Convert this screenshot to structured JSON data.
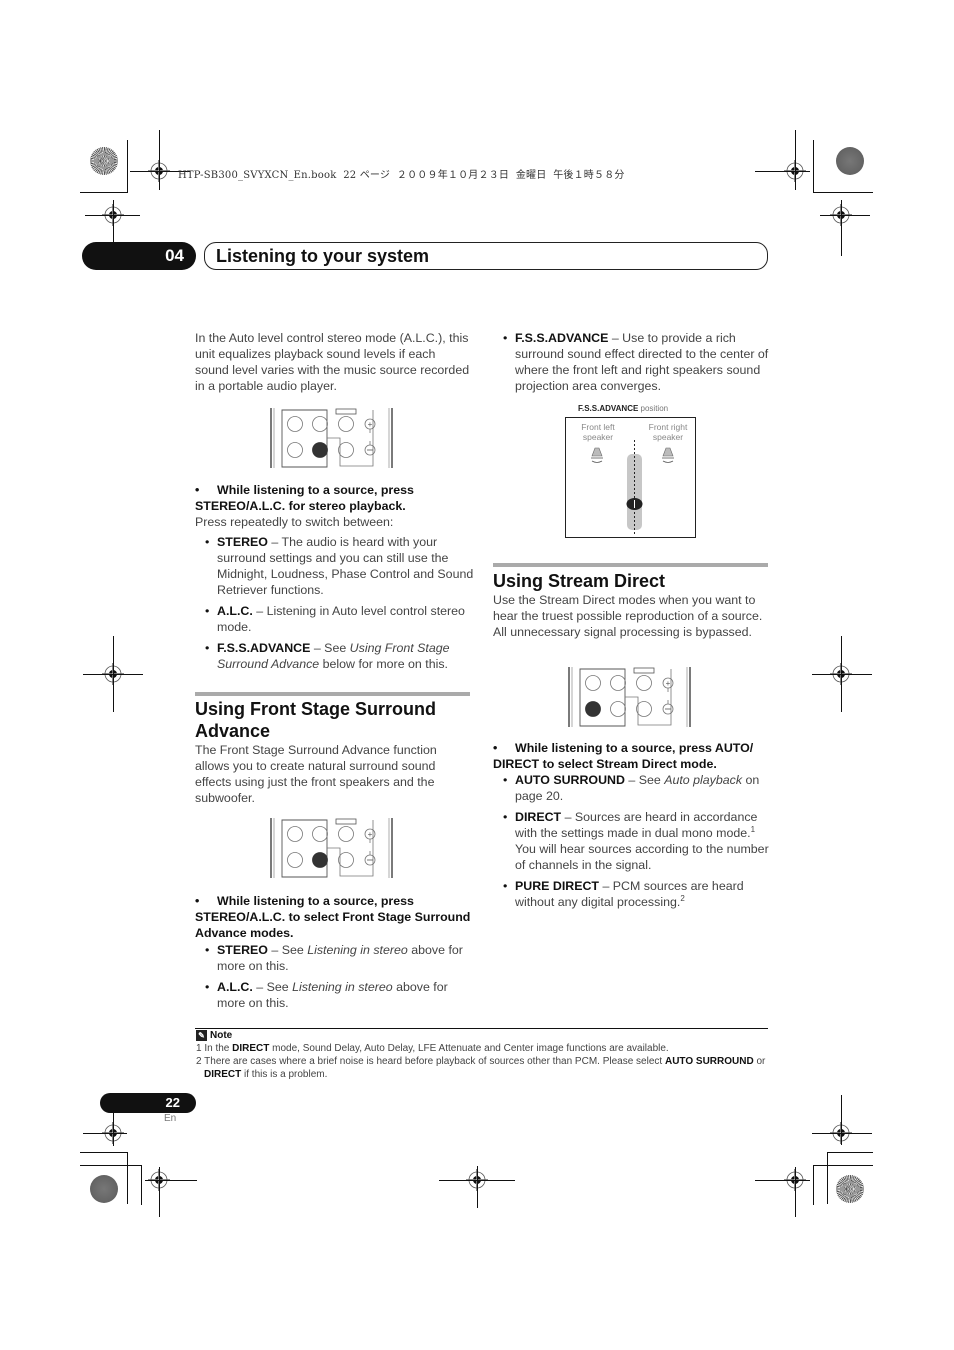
{
  "print_header": "HTP-SB300_SVYXCN_En.book  22 ページ  ２００９年１０月２３日  金曜日  午後１時５８分",
  "chapter": {
    "number": "04",
    "title": "Listening to your system"
  },
  "left_column": {
    "intro": "In the Auto level control stereo mode (A.L.C.), this unit equalizes playback sound levels if each sound level varies with the music source recorded in a portable audio player.",
    "step1": {
      "instruction": "While listening to a source, press STEREO/A.L.C. for stereo playback.",
      "followup": "Press repeatedly to switch between:",
      "items": [
        {
          "term": "STEREO",
          "text": " – The audio is heard with your surround settings and you can still use the Midnight, Loudness, Phase Control and Sound Retriever functions."
        },
        {
          "term": "A.L.C.",
          "text": " – Listening in Auto level control stereo mode."
        },
        {
          "term": "F.S.S.ADVANCE",
          "pre": " – See ",
          "ref": "Using Front Stage Surround Advance",
          "post": " below for more on this."
        }
      ]
    },
    "section_fss": {
      "title": "Using Front Stage Surround Advance",
      "body": "The Front Stage Surround Advance function allows you to create natural surround sound effects using just the front speakers and the subwoofer.",
      "step": {
        "instruction": "While listening to a source, press STEREO/A.L.C. to select Front Stage Surround Advance modes.",
        "items": [
          {
            "term": "STEREO",
            "pre": " – See ",
            "ref": "Listening in stereo",
            "post": " above for more on this."
          },
          {
            "term": "A.L.C.",
            "pre": " – See ",
            "ref": "Listening in stereo",
            "post": " above for more on this."
          }
        ]
      }
    }
  },
  "right_column": {
    "fss_item": {
      "term": "F.S.S.ADVANCE",
      "text": " – Use to provide a rich surround sound effect directed to the center of where the front left and right speakers sound projection area converges."
    },
    "fss_figure": {
      "caption_bold": "F.S.S.ADVANCE",
      "caption_rest": " position",
      "left_label_1": "Front left",
      "left_label_2": "speaker",
      "right_label_1": "Front right",
      "right_label_2": "speaker"
    },
    "section_stream": {
      "title": "Using Stream Direct",
      "body": "Use the Stream Direct modes when you want to hear the truest possible reproduction of a source. All unnecessary signal processing is bypassed.",
      "step": {
        "instruction": "While listening to a source, press AUTO/ DIRECT to select Stream Direct mode.",
        "items": [
          {
            "term": "AUTO SURROUND",
            "pre": " – See ",
            "ref": "Auto playback",
            "post": " on page 20."
          },
          {
            "term": "DIRECT",
            "text_a": " – Sources are heard in accordance with the settings made in dual mono mode.",
            "sup": "1",
            "text_b": " You will hear sources according to the number of channels in the signal."
          },
          {
            "term": "PURE DIRECT",
            "text_a": " – PCM sources are heard without any digital processing.",
            "sup": "2"
          }
        ]
      }
    }
  },
  "notes": {
    "title": "Note",
    "n1_a": "1 In the ",
    "n1_b": "DIRECT",
    "n1_c": " mode, Sound Delay, Auto Delay, LFE Attenuate and Center image functions are available.",
    "n2_a": "2 There are cases where a brief noise is heard before playback of sources other than PCM. Please select ",
    "n2_b": "AUTO SURROUND",
    "n2_c": " or ",
    "n2_d": "DIRECT",
    "n2_e": " if this is a problem."
  },
  "footer": {
    "page_number": "22",
    "language": "En"
  },
  "remote_diagrams": [
    {
      "name": "alc-remote",
      "highlighted_button": "bottom-middle"
    },
    {
      "name": "fss-remote",
      "highlighted_button": "bottom-middle"
    },
    {
      "name": "stream-direct-remote",
      "highlighted_button": "bottom-left"
    }
  ]
}
